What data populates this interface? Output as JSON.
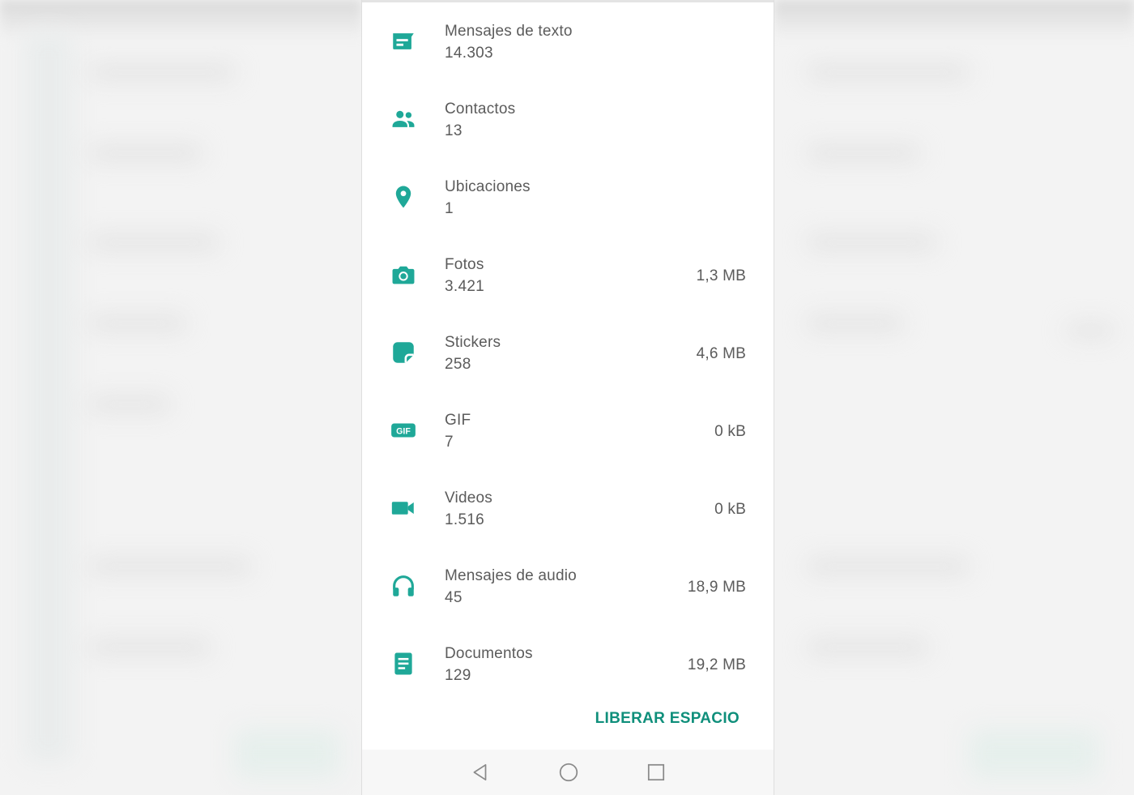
{
  "colors": {
    "accent": "#1fa898",
    "button_text": "#0f8f7b",
    "text": "#5b5b5b"
  },
  "items": [
    {
      "icon": "message-icon",
      "title": "Mensajes de texto",
      "count": "14.303",
      "size": ""
    },
    {
      "icon": "contacts-icon",
      "title": "Contactos",
      "count": "13",
      "size": ""
    },
    {
      "icon": "location-icon",
      "title": "Ubicaciones",
      "count": "1",
      "size": ""
    },
    {
      "icon": "camera-icon",
      "title": "Fotos",
      "count": "3.421",
      "size": "1,3 MB"
    },
    {
      "icon": "sticker-icon",
      "title": "Stickers",
      "count": "258",
      "size": "4,6 MB"
    },
    {
      "icon": "gif-icon",
      "title": "GIF",
      "count": "7",
      "size": "0 kB"
    },
    {
      "icon": "video-icon",
      "title": "Videos",
      "count": "1.516",
      "size": "0 kB"
    },
    {
      "icon": "headphones-icon",
      "title": "Mensajes de audio",
      "count": "45",
      "size": "18,9 MB"
    },
    {
      "icon": "document-icon",
      "title": "Documentos",
      "count": "129",
      "size": "19,2 MB"
    }
  ],
  "actions": {
    "free_space_label": "LIBERAR ESPACIO"
  },
  "navigation": {
    "back": "back-icon",
    "home": "home-icon",
    "recents": "recents-icon"
  }
}
